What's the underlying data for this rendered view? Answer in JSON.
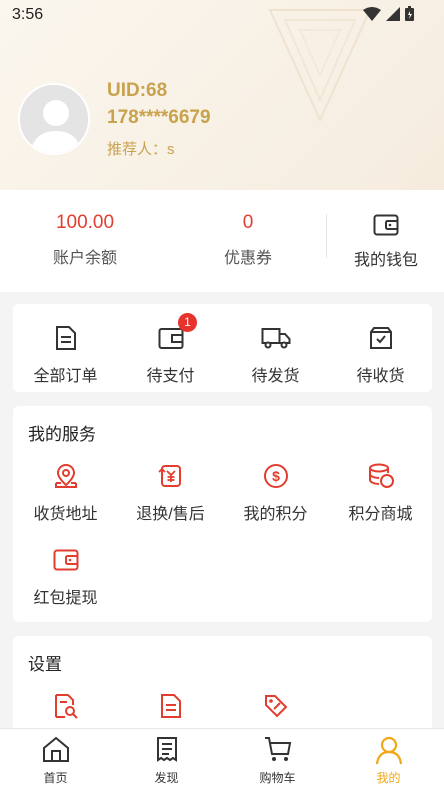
{
  "status_bar": {
    "time": "3:56"
  },
  "profile": {
    "uid": "UID:68",
    "phone": "178****6679",
    "referrer": "推荐人：s"
  },
  "stats": {
    "balance_value": "100.00",
    "balance_label": "账户余额",
    "coupon_value": "0",
    "coupon_label": "优惠券",
    "wallet_label": "我的钱包"
  },
  "orders": [
    {
      "label": "全部订单",
      "icon": "order-list-icon"
    },
    {
      "label": "待支付",
      "icon": "wallet-pay-icon",
      "badge": "1"
    },
    {
      "label": "待发货",
      "icon": "truck-icon"
    },
    {
      "label": "待收货",
      "icon": "receive-box-icon"
    }
  ],
  "services": {
    "title": "我的服务",
    "items": [
      {
        "label": "收货地址",
        "icon": "map-pin-icon"
      },
      {
        "label": "退换/售后",
        "icon": "refund-icon"
      },
      {
        "label": "我的积分",
        "icon": "points-icon"
      },
      {
        "label": "积分商城",
        "icon": "coins-stack-icon"
      },
      {
        "label": "红包提现",
        "icon": "red-packet-wallet-icon"
      }
    ]
  },
  "settings": {
    "title": "设置",
    "items": [
      {
        "icon": "document-search-icon"
      },
      {
        "icon": "document-icon"
      },
      {
        "icon": "tag-icon"
      }
    ]
  },
  "tabbar": [
    {
      "label": "首页",
      "icon": "home-icon"
    },
    {
      "label": "发现",
      "icon": "discover-icon"
    },
    {
      "label": "购物车",
      "icon": "cart-icon"
    },
    {
      "label": "我的",
      "icon": "user-icon",
      "active": true
    }
  ],
  "colors": {
    "accent_gold": "#c9a24d",
    "red": "#e23d2f",
    "active_tab": "#f0a817"
  }
}
